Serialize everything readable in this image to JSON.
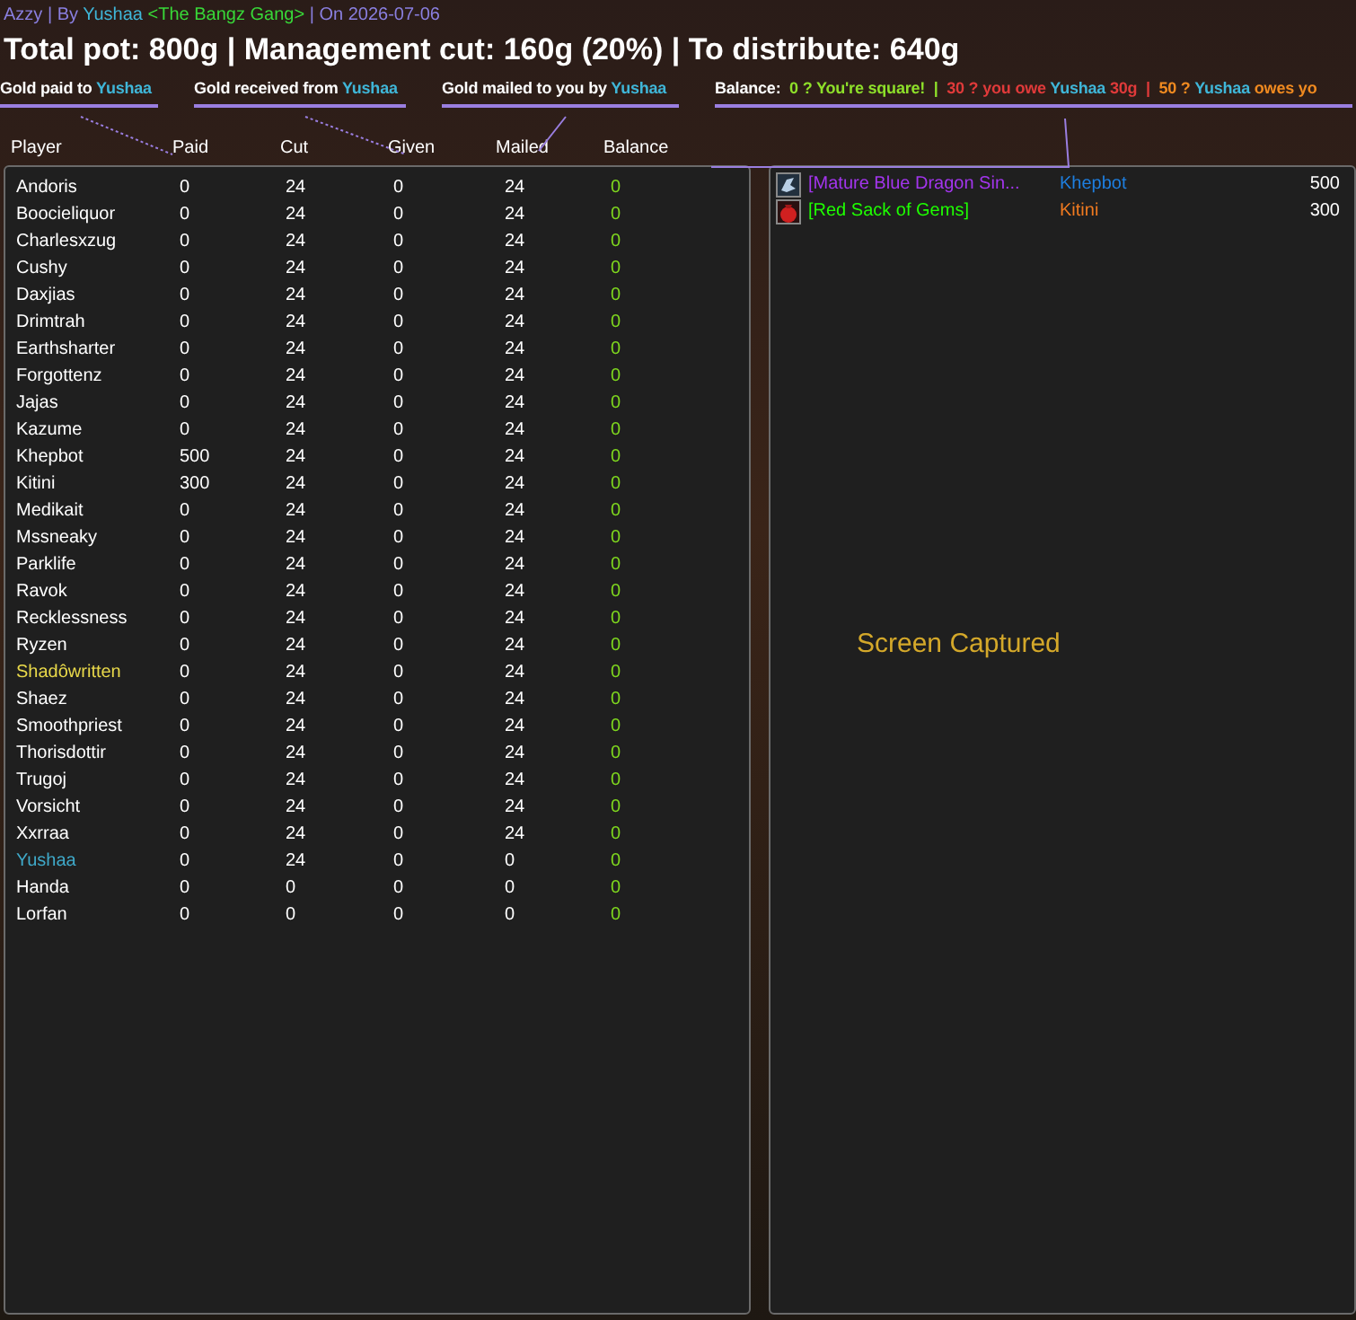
{
  "byline": [
    {
      "text": "Azzy | By ",
      "color": "#8a7fe0"
    },
    {
      "text": "Yushaa",
      "color": "#3fb6d8"
    },
    {
      "text": " <The Bangz Gang>",
      "color": "#38d838"
    },
    {
      "text": " | On 2026-07-06",
      "color": "#8a7fe0"
    }
  ],
  "title": "Total pot: 800g | Management cut: 160g (20%) | To distribute: 640g",
  "legend": [
    {
      "parts": [
        {
          "text": "Gold paid to ",
          "color": "#ffffff"
        },
        {
          "text": "Yushaa",
          "color": "#3fb6d8"
        }
      ]
    },
    {
      "parts": [
        {
          "text": "Gold received from ",
          "color": "#ffffff"
        },
        {
          "text": "Yushaa",
          "color": "#3fb6d8"
        }
      ]
    },
    {
      "parts": [
        {
          "text": "Gold mailed to you by ",
          "color": "#ffffff"
        },
        {
          "text": "Yushaa",
          "color": "#3fb6d8"
        }
      ]
    },
    {
      "parts": [
        {
          "text": "Balance:  ",
          "color": "#ffffff"
        },
        {
          "text": "0 ? You're square!  |  ",
          "color": "#8ee02a"
        },
        {
          "text": "30 ? you owe ",
          "color": "#e03a3a"
        },
        {
          "text": "Yushaa",
          "color": "#3fb6d8"
        },
        {
          "text": " 30g  |  ",
          "color": "#e03a3a"
        },
        {
          "text": "50 ? ",
          "color": "#f08a20"
        },
        {
          "text": "Yushaa",
          "color": "#3fb6d8"
        },
        {
          "text": " owes yo",
          "color": "#f08a20"
        }
      ]
    }
  ],
  "columns": [
    "Player",
    "Paid",
    "Cut",
    "Given",
    "Mailed",
    "Balance"
  ],
  "rows": [
    {
      "player": "Andoris",
      "color": "#ffffff",
      "paid": "0",
      "cut": "24",
      "given": "0",
      "mailed": "24",
      "balance": "0"
    },
    {
      "player": "Boocieliquor",
      "color": "#ffffff",
      "paid": "0",
      "cut": "24",
      "given": "0",
      "mailed": "24",
      "balance": "0"
    },
    {
      "player": "Charlesxzug",
      "color": "#ffffff",
      "paid": "0",
      "cut": "24",
      "given": "0",
      "mailed": "24",
      "balance": "0"
    },
    {
      "player": "Cushy",
      "color": "#ffffff",
      "paid": "0",
      "cut": "24",
      "given": "0",
      "mailed": "24",
      "balance": "0"
    },
    {
      "player": "Daxjias",
      "color": "#ffffff",
      "paid": "0",
      "cut": "24",
      "given": "0",
      "mailed": "24",
      "balance": "0"
    },
    {
      "player": "Drimtrah",
      "color": "#ffffff",
      "paid": "0",
      "cut": "24",
      "given": "0",
      "mailed": "24",
      "balance": "0"
    },
    {
      "player": "Earthsharter",
      "color": "#ffffff",
      "paid": "0",
      "cut": "24",
      "given": "0",
      "mailed": "24",
      "balance": "0"
    },
    {
      "player": "Forgottenz",
      "color": "#ffffff",
      "paid": "0",
      "cut": "24",
      "given": "0",
      "mailed": "24",
      "balance": "0"
    },
    {
      "player": "Jajas",
      "color": "#ffffff",
      "paid": "0",
      "cut": "24",
      "given": "0",
      "mailed": "24",
      "balance": "0"
    },
    {
      "player": "Kazume",
      "color": "#ffffff",
      "paid": "0",
      "cut": "24",
      "given": "0",
      "mailed": "24",
      "balance": "0"
    },
    {
      "player": "Khepbot",
      "color": "#ffffff",
      "paid": "500",
      "cut": "24",
      "given": "0",
      "mailed": "24",
      "balance": "0"
    },
    {
      "player": "Kitini",
      "color": "#ffffff",
      "paid": "300",
      "cut": "24",
      "given": "0",
      "mailed": "24",
      "balance": "0"
    },
    {
      "player": "Medikait",
      "color": "#ffffff",
      "paid": "0",
      "cut": "24",
      "given": "0",
      "mailed": "24",
      "balance": "0"
    },
    {
      "player": "Mssneaky",
      "color": "#ffffff",
      "paid": "0",
      "cut": "24",
      "given": "0",
      "mailed": "24",
      "balance": "0"
    },
    {
      "player": "Parklife",
      "color": "#ffffff",
      "paid": "0",
      "cut": "24",
      "given": "0",
      "mailed": "24",
      "balance": "0"
    },
    {
      "player": "Ravok",
      "color": "#ffffff",
      "paid": "0",
      "cut": "24",
      "given": "0",
      "mailed": "24",
      "balance": "0"
    },
    {
      "player": "Recklessness",
      "color": "#ffffff",
      "paid": "0",
      "cut": "24",
      "given": "0",
      "mailed": "24",
      "balance": "0"
    },
    {
      "player": "Ryzen",
      "color": "#ffffff",
      "paid": "0",
      "cut": "24",
      "given": "0",
      "mailed": "24",
      "balance": "0"
    },
    {
      "player": "Shadôwritten",
      "color": "#e8d84a",
      "paid": "0",
      "cut": "24",
      "given": "0",
      "mailed": "24",
      "balance": "0"
    },
    {
      "player": "Shaez",
      "color": "#ffffff",
      "paid": "0",
      "cut": "24",
      "given": "0",
      "mailed": "24",
      "balance": "0"
    },
    {
      "player": "Smoothpriest",
      "color": "#ffffff",
      "paid": "0",
      "cut": "24",
      "given": "0",
      "mailed": "24",
      "balance": "0"
    },
    {
      "player": "Thorisdottir",
      "color": "#ffffff",
      "paid": "0",
      "cut": "24",
      "given": "0",
      "mailed": "24",
      "balance": "0"
    },
    {
      "player": "Trugoj",
      "color": "#ffffff",
      "paid": "0",
      "cut": "24",
      "given": "0",
      "mailed": "24",
      "balance": "0"
    },
    {
      "player": "Vorsicht",
      "color": "#ffffff",
      "paid": "0",
      "cut": "24",
      "given": "0",
      "mailed": "24",
      "balance": "0"
    },
    {
      "player": "Xxrraa",
      "color": "#ffffff",
      "paid": "0",
      "cut": "24",
      "given": "0",
      "mailed": "24",
      "balance": "0"
    },
    {
      "player": "Yushaa",
      "color": "#3fa9c9",
      "paid": "0",
      "cut": "24",
      "given": "0",
      "mailed": "0",
      "balance": "0"
    },
    {
      "player": "Handa",
      "color": "#ffffff",
      "paid": "0",
      "cut": "0",
      "given": "0",
      "mailed": "0",
      "balance": "0"
    },
    {
      "player": "Lorfan",
      "color": "#ffffff",
      "paid": "0",
      "cut": "0",
      "given": "0",
      "mailed": "0",
      "balance": "0"
    }
  ],
  "loot": [
    {
      "kind": "dragon",
      "item": {
        "text": "[Mature Blue Dragon Sin...",
        "color": "#a335ee"
      },
      "winner": {
        "text": "Khepbot",
        "color": "#1e7fe0"
      },
      "amount": "500"
    },
    {
      "kind": "sack",
      "item": {
        "text": "[Red Sack of Gems]",
        "color": "#1eff00"
      },
      "winner": {
        "text": "Kitini",
        "color": "#f07a20"
      },
      "amount": "300"
    }
  ],
  "overlay_text": "Screen Captured"
}
